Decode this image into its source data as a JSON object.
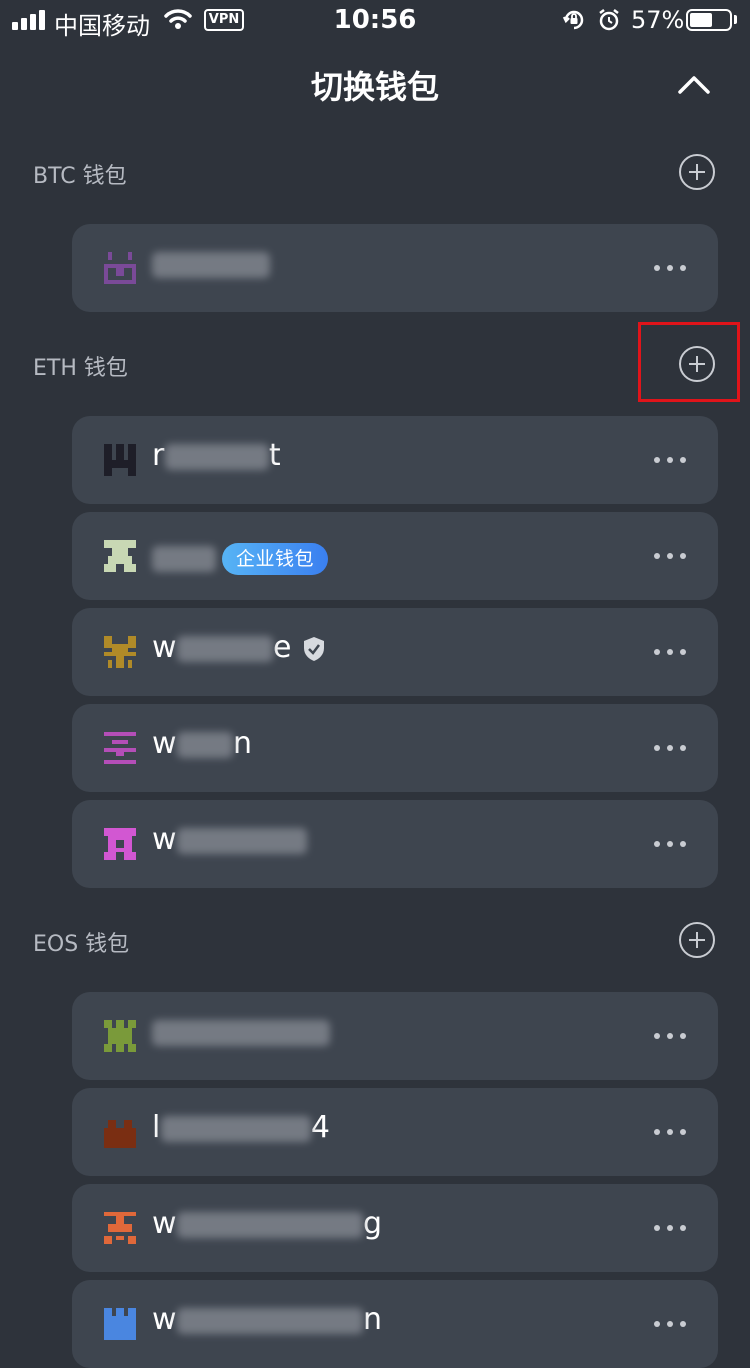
{
  "status_bar": {
    "carrier": "中国移动",
    "vpn": "VPN",
    "time": "10:56",
    "battery_percent_label": "57%",
    "battery_level": 0.57
  },
  "header": {
    "title": "切换钱包",
    "collapse_icon": "chevron-up-icon"
  },
  "sections": [
    {
      "title": "BTC 钱包",
      "wallets": [
        {
          "name_visible": "",
          "avatar_color": "#7a4a98",
          "obscured": true
        }
      ]
    },
    {
      "title": "ETH 钱包",
      "wallets": [
        {
          "name_start": "r",
          "name_end": "t",
          "avatar_color": "#1e1e28"
        },
        {
          "name_start": "",
          "name_end": "",
          "avatar_color": "#c8d8b4",
          "badge": "企业钱包"
        },
        {
          "name_start": "w",
          "name_end": "e",
          "avatar_color": "#b08a28",
          "verified_icon": "shield-check-icon"
        },
        {
          "name_start": "w",
          "name_end": "n",
          "avatar_color": "#b44eb8"
        },
        {
          "name_start": "w",
          "name_end": "",
          "avatar_color": "#d257d2"
        }
      ]
    },
    {
      "title": "EOS 钱包",
      "wallets": [
        {
          "name_start": "",
          "name_end": "",
          "avatar_color": "#7a9a3a"
        },
        {
          "name_start": "l",
          "name_end": "4",
          "avatar_color": "#7a2e12"
        },
        {
          "name_start": "w",
          "name_end": "g",
          "avatar_color": "#e0683a"
        },
        {
          "name_start": "w",
          "name_end": "n",
          "avatar_color": "#4a86e0"
        }
      ]
    }
  ],
  "colors": {
    "background": "#2e333b",
    "card": "#3e454f",
    "highlight": "#e0141a",
    "badge_start": "#57b4f5",
    "badge_end": "#3a7ff0"
  }
}
